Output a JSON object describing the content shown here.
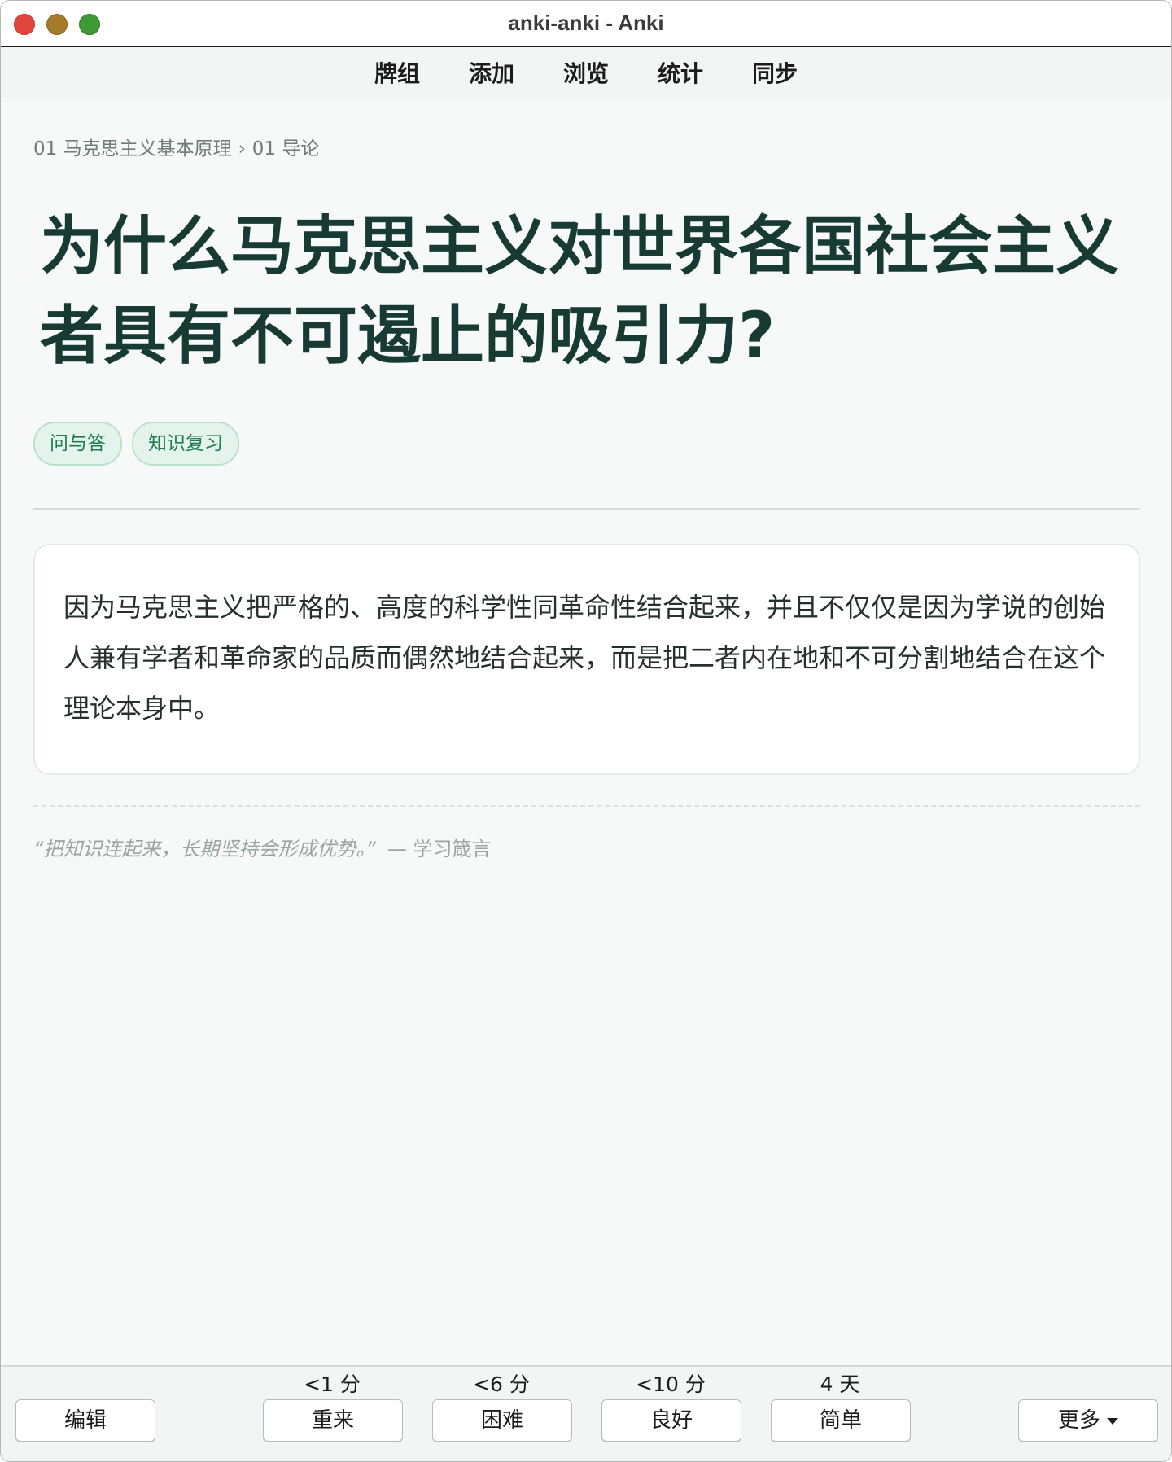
{
  "window": {
    "title": "anki-anki - Anki"
  },
  "toolbar": {
    "items": [
      "牌组",
      "添加",
      "浏览",
      "统计",
      "同步"
    ]
  },
  "card": {
    "breadcrumb": {
      "deck": "01 马克思主义基本原理",
      "separator": "›",
      "subdeck": "01 导论"
    },
    "question": "为什么马克思主义对世界各国社会主义者具有不可遏止的吸引力?",
    "tags": [
      "问与答",
      "知识复习"
    ],
    "answer": "因为马克思主义把严格的、高度的科学性同革命性结合起来，并且不仅仅是因为学说的创始人兼有学者和革命家的品质而偶然地结合起来，而是把二者内在地和不可分割地结合在这个理论本身中。",
    "quote": {
      "text": "“把知识连起来，长期坚持会形成优势。”",
      "source": "— 学习箴言"
    }
  },
  "review": {
    "edit_label": "编辑",
    "more_label": "更多",
    "answers": [
      {
        "interval": "<1 分",
        "label": "重来"
      },
      {
        "interval": "<6 分",
        "label": "困难"
      },
      {
        "interval": "<10 分",
        "label": "良好"
      },
      {
        "interval": "4 天",
        "label": "简单"
      }
    ]
  },
  "colors": {
    "question_text": "#173a32",
    "tag_bg": "#e4f4ec",
    "tag_text": "#1f7a53",
    "close": "#e0463b",
    "minimize": "#a47a2c",
    "maximize": "#3f9a35"
  }
}
